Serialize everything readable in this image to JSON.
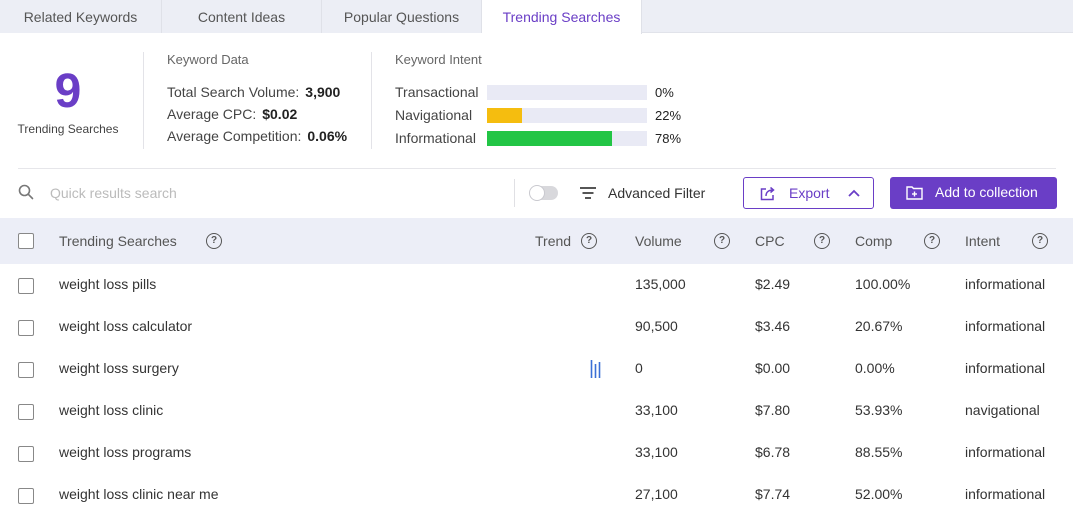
{
  "tabs": [
    {
      "label": "Related Keywords"
    },
    {
      "label": "Content Ideas"
    },
    {
      "label": "Popular Questions"
    },
    {
      "label": "Trending Searches"
    }
  ],
  "summary": {
    "count": "9",
    "count_label": "Trending Searches"
  },
  "keyword_data": {
    "title": "Keyword Data",
    "total_volume_label": "Total Search Volume:",
    "total_volume": "3,900",
    "avg_cpc_label": "Average CPC:",
    "avg_cpc": "$0.02",
    "avg_comp_label": "Average Competition:",
    "avg_comp": "0.06%"
  },
  "keyword_intent": {
    "title": "Keyword Intent",
    "items": [
      {
        "label": "Transactional",
        "percent_text": "0%",
        "fraction": 0.0,
        "color": "#f5bd0f"
      },
      {
        "label": "Navigational",
        "percent_text": "22%",
        "fraction": 0.22,
        "color": "#f5bd0f"
      },
      {
        "label": "Informational",
        "percent_text": "78%",
        "fraction": 0.78,
        "color": "#22c545"
      }
    ]
  },
  "toolbar": {
    "search_placeholder": "Quick results search",
    "filter_label": "Advanced Filter",
    "export_label": "Export",
    "collection_label": "Add to collection"
  },
  "table": {
    "headers": {
      "keyword": "Trending Searches",
      "trend": "Trend",
      "volume": "Volume",
      "cpc": "CPC",
      "comp": "Comp",
      "intent": "Intent"
    },
    "rows": [
      {
        "keyword": "weight loss pills",
        "volume": "135,000",
        "cpc": "$2.49",
        "comp": "100.00%",
        "intent": "informational"
      },
      {
        "keyword": "weight loss calculator",
        "volume": "90,500",
        "cpc": "$3.46",
        "comp": "20.67%",
        "intent": "informational"
      },
      {
        "keyword": "weight loss surgery",
        "volume": "0",
        "cpc": "$0.00",
        "comp": "0.00%",
        "intent": "informational"
      },
      {
        "keyword": "weight loss clinic",
        "volume": "33,100",
        "cpc": "$7.80",
        "comp": "53.93%",
        "intent": "navigational"
      },
      {
        "keyword": "weight loss programs",
        "volume": "33,100",
        "cpc": "$6.78",
        "comp": "88.55%",
        "intent": "informational"
      },
      {
        "keyword": "weight loss clinic near me",
        "volume": "27,100",
        "cpc": "$7.74",
        "comp": "52.00%",
        "intent": "informational"
      }
    ]
  },
  "colors": {
    "accent": "#6a3ec6",
    "header_bg": "#eceef7",
    "trend_bar": "#3b6fd6"
  }
}
